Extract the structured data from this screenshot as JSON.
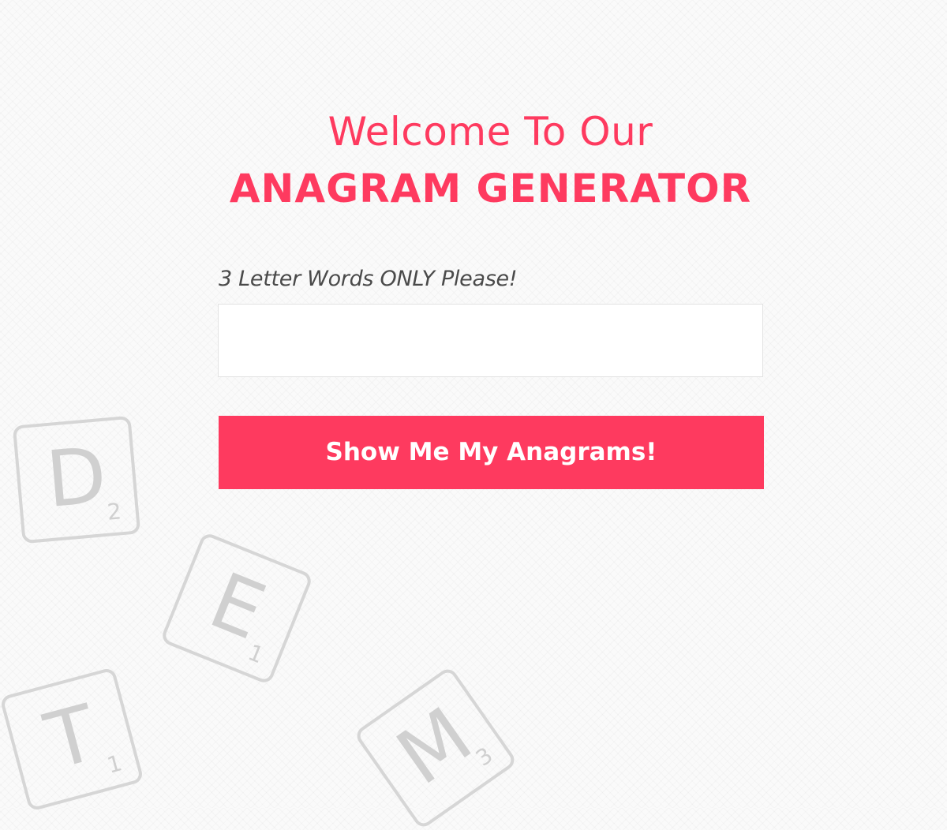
{
  "heading": {
    "line1": "Welcome To Our",
    "line2": "ANAGRAM GENERATOR"
  },
  "form": {
    "label": "3 Letter Words ONLY Please!",
    "input_value": "",
    "submit_label": "Show Me My Anagrams!"
  },
  "decorative_tiles": [
    {
      "letter": "D",
      "points": "2"
    },
    {
      "letter": "E",
      "points": "1"
    },
    {
      "letter": "T",
      "points": "1"
    },
    {
      "letter": "M",
      "points": "3"
    }
  ],
  "colors": {
    "accent": "#fe3a5f",
    "label_text": "#4a4a4a",
    "tile_gray": "#d6d6d6"
  }
}
